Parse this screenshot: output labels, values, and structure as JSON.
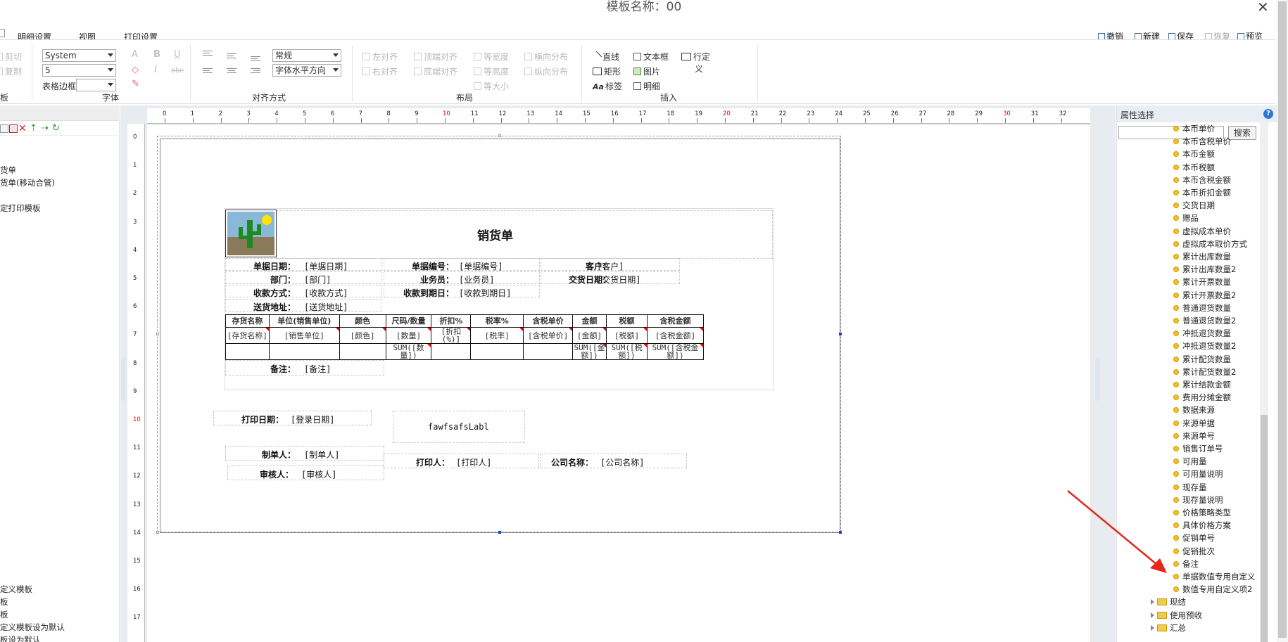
{
  "window": {
    "title": "模板名称：00",
    "close": "✕"
  },
  "menu": {
    "tabs": [
      "明细设置",
      "视图",
      "打印设置"
    ]
  },
  "actions": {
    "undo": "撤销",
    "new": "新建",
    "save": "保存",
    "restore": "恢复",
    "preview": "预览"
  },
  "ribbon": {
    "clipboard": {
      "cut": "剪切",
      "copy": "复制",
      "group_tail": "板"
    },
    "font": {
      "family": "System",
      "size": "5",
      "border_label": "表格边框",
      "border_value": "",
      "group": "字体",
      "b": "B",
      "i": "I",
      "u": "U",
      "a": "A",
      "strike": "abc"
    },
    "align": {
      "group": "对齐方式",
      "style_value": "常规",
      "halign_value": "字体水平方向"
    },
    "layout": {
      "group": "布局",
      "left": "左对齐",
      "right": "右对齐",
      "top": "顶端对齐",
      "bottom": "底端对齐",
      "same_width": "等宽度",
      "same_height": "等高度",
      "same_size": "等大小",
      "h_dist": "横向分布",
      "v_dist": "纵向分布"
    },
    "insert": {
      "group": "插入",
      "line": "直线",
      "rect": "矩形",
      "label": "标签",
      "textbox": "文本框",
      "image": "图片",
      "detail": "明细",
      "custom_row": "行定",
      "custom_row2": "义"
    }
  },
  "left_panel": {
    "items_top": [
      "货单",
      "货单(移动合管)",
      "定打印模板"
    ],
    "items_bottom": [
      "定义模板",
      "板",
      "板",
      "定义模板设为默认",
      "板设为默认"
    ]
  },
  "ruler": {
    "h": [
      "0",
      "1",
      "2",
      "3",
      "4",
      "5",
      "6",
      "7",
      "8",
      "9",
      "10",
      "11",
      "12",
      "13",
      "14",
      "15",
      "16",
      "17",
      "18",
      "19",
      "20",
      "21",
      "22",
      "23",
      "24",
      "25",
      "26",
      "27",
      "28",
      "29",
      "30",
      "31",
      "32"
    ],
    "v": [
      "0",
      "1",
      "2",
      "3",
      "4",
      "5",
      "6",
      "7",
      "8",
      "9",
      "10",
      "11",
      "12",
      "13",
      "14",
      "15",
      "16",
      "17",
      "18"
    ]
  },
  "report": {
    "title": "销货单",
    "header_rows": [
      [
        {
          "label": "单据日期：",
          "field": "[单据日期]"
        },
        {
          "label": "单据编号：",
          "field": "[单据编号]"
        },
        {
          "label": "客户：",
          "field": "[客户]"
        }
      ],
      [
        {
          "label": "部门：",
          "field": "[部门]"
        },
        {
          "label": "业务员：",
          "field": "[业务员]"
        },
        {
          "label": "交货日期：",
          "field": "[交货日期]"
        }
      ],
      [
        {
          "label": "收款方式：",
          "field": "[收款方式]"
        },
        {
          "label": "收款到期日：",
          "field": "[收款到期日]"
        }
      ],
      [
        {
          "label": "送货地址：",
          "field": "[送货地址]"
        }
      ]
    ],
    "table": {
      "headers": [
        "存货名称",
        "单位(销售单位)",
        "颜色",
        "尺码/数量",
        "折扣%",
        "税率%",
        "含税单价",
        "金额",
        "税额",
        "含税金额"
      ],
      "fields": [
        "[存货名称]",
        "[销售单位]",
        "[颜色]",
        "[数量]",
        "[折扣(%)]",
        "[税率]",
        "[含税单价]",
        "[金额]",
        "[税额]",
        "[含税金额]"
      ],
      "sums": [
        "",
        "",
        "",
        "SUM([数量])",
        "",
        "",
        "",
        "SUM([金额])",
        "SUM([税额])",
        "SUM([含税金额])"
      ]
    },
    "remark": {
      "label": "备注：",
      "field": "[备注]"
    },
    "footer": {
      "print_date": {
        "label": "打印日期：",
        "field": "[登录日期]"
      },
      "custom_label": "fawfsafsLabl",
      "maker": {
        "label": "制单人：",
        "field": "[制单人]"
      },
      "auditor": {
        "label": "审核人：",
        "field": "[审核人]"
      },
      "printer": {
        "label": "打印人：",
        "field": "[打印人]"
      },
      "company": {
        "label": "公司名称：",
        "field": "[公司名称]"
      }
    }
  },
  "right_panel": {
    "title": "属性选择",
    "help": "?",
    "search_value": "",
    "search_button": "搜索",
    "items": [
      "本币单价",
      "本币含税单价",
      "本币金额",
      "本币税额",
      "本币含税金额",
      "本币折扣金额",
      "交货日期",
      "赠品",
      "虚拟成本单价",
      "虚拟成本取价方式",
      "累计出库数量",
      "累计出库数量2",
      "累计开票数量",
      "累计开票数量2",
      "普通退货数量",
      "普通退货数量2",
      "冲抵退货数量",
      "冲抵退货数量2",
      "累计配货数量",
      "累计配货数量2",
      "累计结款金额",
      "费用分摊金额",
      "数据来源",
      "来源单据",
      "来源单号",
      "销售订单号",
      "可用量",
      "可用量说明",
      "现存量",
      "现存量说明",
      "价格策略类型",
      "具体价格方案",
      "促销单号",
      "促销批次",
      "备注",
      "单据数值专用自定义",
      "数值专用自定义项2"
    ],
    "folders": [
      "现结",
      "使用预收",
      "汇总"
    ]
  },
  "colors": {
    "accent": "#2b78d4",
    "arrow": "#e8241c",
    "ruler_red": "#e00000"
  }
}
